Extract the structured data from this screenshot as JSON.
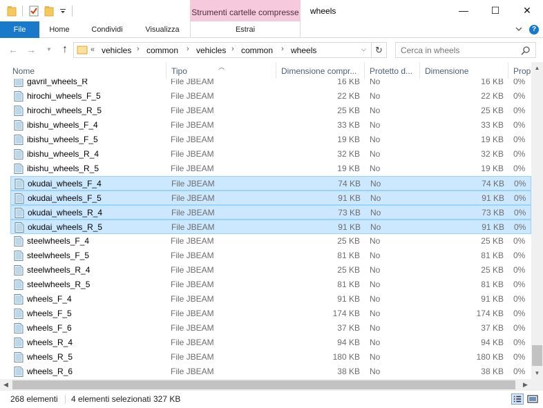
{
  "titlebar": {
    "context_tab": "Strumenti cartelle compresse",
    "window_title": "wheels",
    "minimize": "—",
    "maximize": "☐",
    "close": "✕"
  },
  "ribbon": {
    "tabs": [
      "File",
      "Home",
      "Condividi",
      "Visualizza",
      "Estrai"
    ],
    "help": "?"
  },
  "address": {
    "overflow": "«",
    "breadcrumbs": [
      "vehicles",
      "common",
      "vehicles",
      "common",
      "wheels"
    ]
  },
  "search": {
    "placeholder": "Cerca in wheels"
  },
  "columns": [
    "Nome",
    "Tipo",
    "Dimensione compr...",
    "Protetto d...",
    "Dimensione",
    "Prop"
  ],
  "files": [
    {
      "name": "gavril_wheels_R",
      "type": "File JBEAM",
      "compressed": "16 KB",
      "protected": "No",
      "size": "16 KB",
      "ratio": "0%",
      "selected": false
    },
    {
      "name": "hirochi_wheels_F_5",
      "type": "File JBEAM",
      "compressed": "22 KB",
      "protected": "No",
      "size": "22 KB",
      "ratio": "0%",
      "selected": false
    },
    {
      "name": "hirochi_wheels_R_5",
      "type": "File JBEAM",
      "compressed": "25 KB",
      "protected": "No",
      "size": "25 KB",
      "ratio": "0%",
      "selected": false
    },
    {
      "name": "ibishu_wheels_F_4",
      "type": "File JBEAM",
      "compressed": "33 KB",
      "protected": "No",
      "size": "33 KB",
      "ratio": "0%",
      "selected": false
    },
    {
      "name": "ibishu_wheels_F_5",
      "type": "File JBEAM",
      "compressed": "19 KB",
      "protected": "No",
      "size": "19 KB",
      "ratio": "0%",
      "selected": false
    },
    {
      "name": "ibishu_wheels_R_4",
      "type": "File JBEAM",
      "compressed": "32 KB",
      "protected": "No",
      "size": "32 KB",
      "ratio": "0%",
      "selected": false
    },
    {
      "name": "ibishu_wheels_R_5",
      "type": "File JBEAM",
      "compressed": "19 KB",
      "protected": "No",
      "size": "19 KB",
      "ratio": "0%",
      "selected": false
    },
    {
      "name": "okudai_wheels_F_4",
      "type": "File JBEAM",
      "compressed": "74 KB",
      "protected": "No",
      "size": "74 KB",
      "ratio": "0%",
      "selected": true
    },
    {
      "name": "okudai_wheels_F_5",
      "type": "File JBEAM",
      "compressed": "91 KB",
      "protected": "No",
      "size": "91 KB",
      "ratio": "0%",
      "selected": true
    },
    {
      "name": "okudai_wheels_R_4",
      "type": "File JBEAM",
      "compressed": "73 KB",
      "protected": "No",
      "size": "73 KB",
      "ratio": "0%",
      "selected": true
    },
    {
      "name": "okudai_wheels_R_5",
      "type": "File JBEAM",
      "compressed": "91 KB",
      "protected": "No",
      "size": "91 KB",
      "ratio": "0%",
      "selected": true
    },
    {
      "name": "steelwheels_F_4",
      "type": "File JBEAM",
      "compressed": "25 KB",
      "protected": "No",
      "size": "25 KB",
      "ratio": "0%",
      "selected": false
    },
    {
      "name": "steelwheels_F_5",
      "type": "File JBEAM",
      "compressed": "81 KB",
      "protected": "No",
      "size": "81 KB",
      "ratio": "0%",
      "selected": false
    },
    {
      "name": "steelwheels_R_4",
      "type": "File JBEAM",
      "compressed": "25 KB",
      "protected": "No",
      "size": "25 KB",
      "ratio": "0%",
      "selected": false
    },
    {
      "name": "steelwheels_R_5",
      "type": "File JBEAM",
      "compressed": "81 KB",
      "protected": "No",
      "size": "81 KB",
      "ratio": "0%",
      "selected": false
    },
    {
      "name": "wheels_F_4",
      "type": "File JBEAM",
      "compressed": "91 KB",
      "protected": "No",
      "size": "91 KB",
      "ratio": "0%",
      "selected": false
    },
    {
      "name": "wheels_F_5",
      "type": "File JBEAM",
      "compressed": "174 KB",
      "protected": "No",
      "size": "174 KB",
      "ratio": "0%",
      "selected": false
    },
    {
      "name": "wheels_F_6",
      "type": "File JBEAM",
      "compressed": "37 KB",
      "protected": "No",
      "size": "37 KB",
      "ratio": "0%",
      "selected": false
    },
    {
      "name": "wheels_R_4",
      "type": "File JBEAM",
      "compressed": "94 KB",
      "protected": "No",
      "size": "94 KB",
      "ratio": "0%",
      "selected": false
    },
    {
      "name": "wheels_R_5",
      "type": "File JBEAM",
      "compressed": "180 KB",
      "protected": "No",
      "size": "180 KB",
      "ratio": "0%",
      "selected": false
    },
    {
      "name": "wheels_R_6",
      "type": "File JBEAM",
      "compressed": "38 KB",
      "protected": "No",
      "size": "38 KB",
      "ratio": "0%",
      "selected": false
    }
  ],
  "status": {
    "count": "268 elementi",
    "selected": "4 elementi selezionati",
    "selected_size": "327 KB"
  },
  "colors": {
    "file_tab": "#1979ca",
    "context_tab": "#f7c9dc",
    "selection": "#cce8ff",
    "selection_border": "#99d1ff",
    "header_text": "#4c607a"
  },
  "icons": {
    "quick_access": [
      "folder-icon",
      "properties-icon",
      "new-folder-icon",
      "customize-dropdown-icon"
    ],
    "file": "jbeam-file-icon"
  }
}
